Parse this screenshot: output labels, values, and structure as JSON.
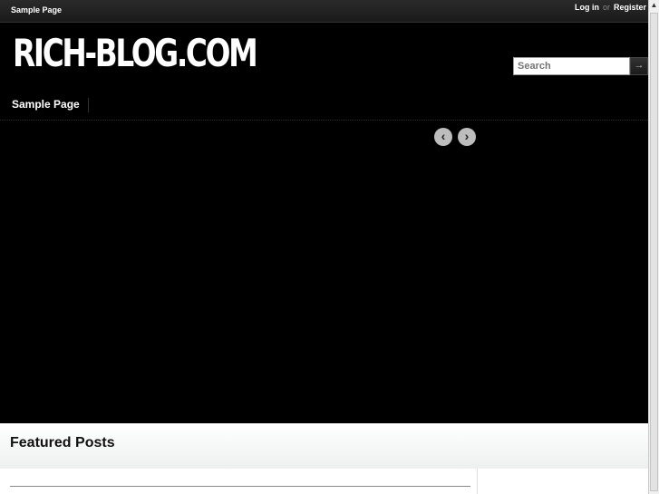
{
  "topbar": {
    "page_link": "Sample Page",
    "login": "Log in",
    "or": "or",
    "register": "Register"
  },
  "site": {
    "logo": "RICH-BLOG.COM"
  },
  "search": {
    "placeholder": "Search",
    "button_icon": "→"
  },
  "nav": {
    "items": [
      {
        "label": "Sample Page"
      }
    ]
  },
  "slider": {
    "prev_icon": "‹",
    "next_icon": "›"
  },
  "featured": {
    "title": "Featured Posts"
  },
  "scrollbar": {
    "up_icon": "▲"
  }
}
